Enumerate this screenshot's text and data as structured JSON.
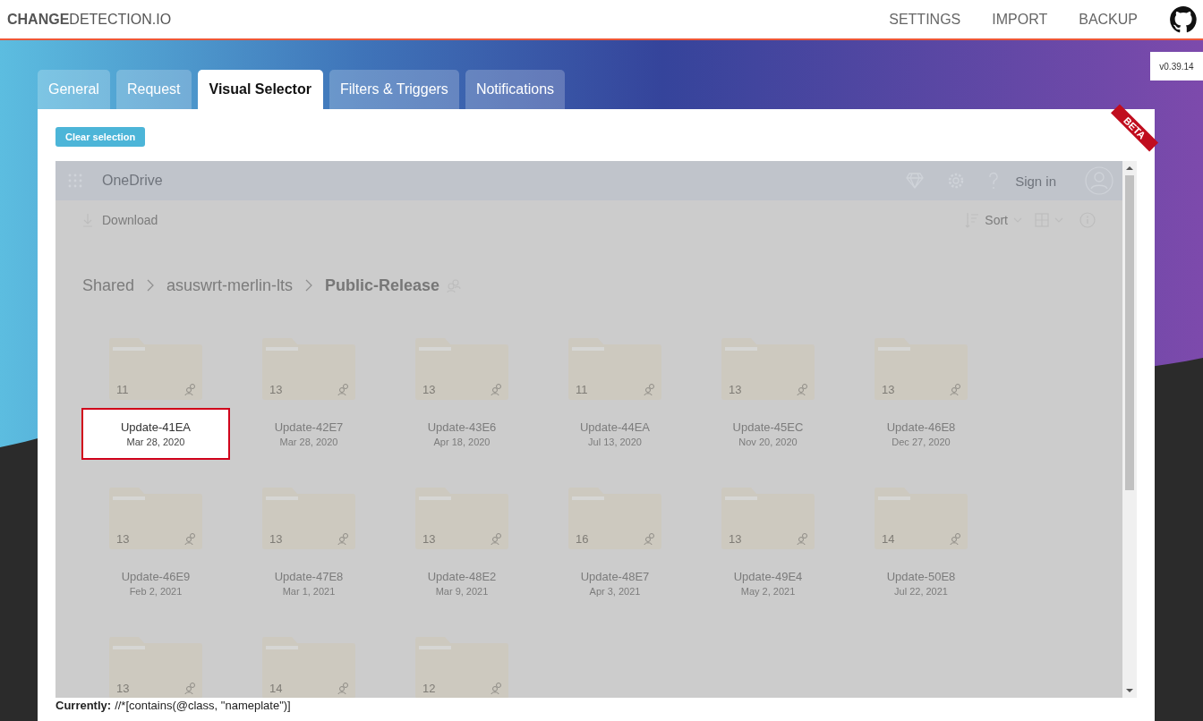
{
  "header": {
    "logo": "**CHANGE**DETECTION.IO",
    "nav": [
      "SETTINGS",
      "IMPORT",
      "BACKUP"
    ]
  },
  "version": "v0.39.14",
  "tabs": [
    {
      "label": "General",
      "selected": false
    },
    {
      "label": "Request",
      "selected": false
    },
    {
      "label": "Visual Selector",
      "selected": true
    },
    {
      "label": "Filters & Triggers",
      "selected": false
    },
    {
      "label": "Notifications",
      "selected": false
    }
  ],
  "beta_ribbon": "BETA",
  "clear_button": "Clear selection",
  "preview": {
    "app_name": "OneDrive",
    "sign_in": "Sign in",
    "download": "Download",
    "sort": "Sort",
    "breadcrumb": [
      "Shared",
      "asuswrt-merlin-lts",
      "Public-Release"
    ],
    "folders": [
      {
        "name": "Update-41EA",
        "date": "Mar 28, 2020",
        "count": "11",
        "selected": true
      },
      {
        "name": "Update-42E7",
        "date": "Mar 28, 2020",
        "count": "13",
        "selected": false
      },
      {
        "name": "Update-43E6",
        "date": "Apr 18, 2020",
        "count": "13",
        "selected": false
      },
      {
        "name": "Update-44EA",
        "date": "Jul 13, 2020",
        "count": "11",
        "selected": false
      },
      {
        "name": "Update-45EC",
        "date": "Nov 20, 2020",
        "count": "13",
        "selected": false
      },
      {
        "name": "Update-46E8",
        "date": "Dec 27, 2020",
        "count": "13",
        "selected": false
      },
      {
        "name": "Update-46E9",
        "date": "Feb 2, 2021",
        "count": "13",
        "selected": false
      },
      {
        "name": "Update-47E8",
        "date": "Mar 1, 2021",
        "count": "13",
        "selected": false
      },
      {
        "name": "Update-48E2",
        "date": "Mar 9, 2021",
        "count": "13",
        "selected": false
      },
      {
        "name": "Update-48E7",
        "date": "Apr 3, 2021",
        "count": "16",
        "selected": false
      },
      {
        "name": "Update-49E4",
        "date": "May 2, 2021",
        "count": "13",
        "selected": false
      },
      {
        "name": "Update-50E8",
        "date": "Jul 22, 2021",
        "count": "14",
        "selected": false
      },
      {
        "count": "13",
        "selected": false
      },
      {
        "count": "14",
        "selected": false
      },
      {
        "count": "12",
        "selected": false
      }
    ]
  },
  "current_selector": {
    "label": "Currently:",
    "value": "//*[contains(@class, \"nameplate\")]"
  }
}
